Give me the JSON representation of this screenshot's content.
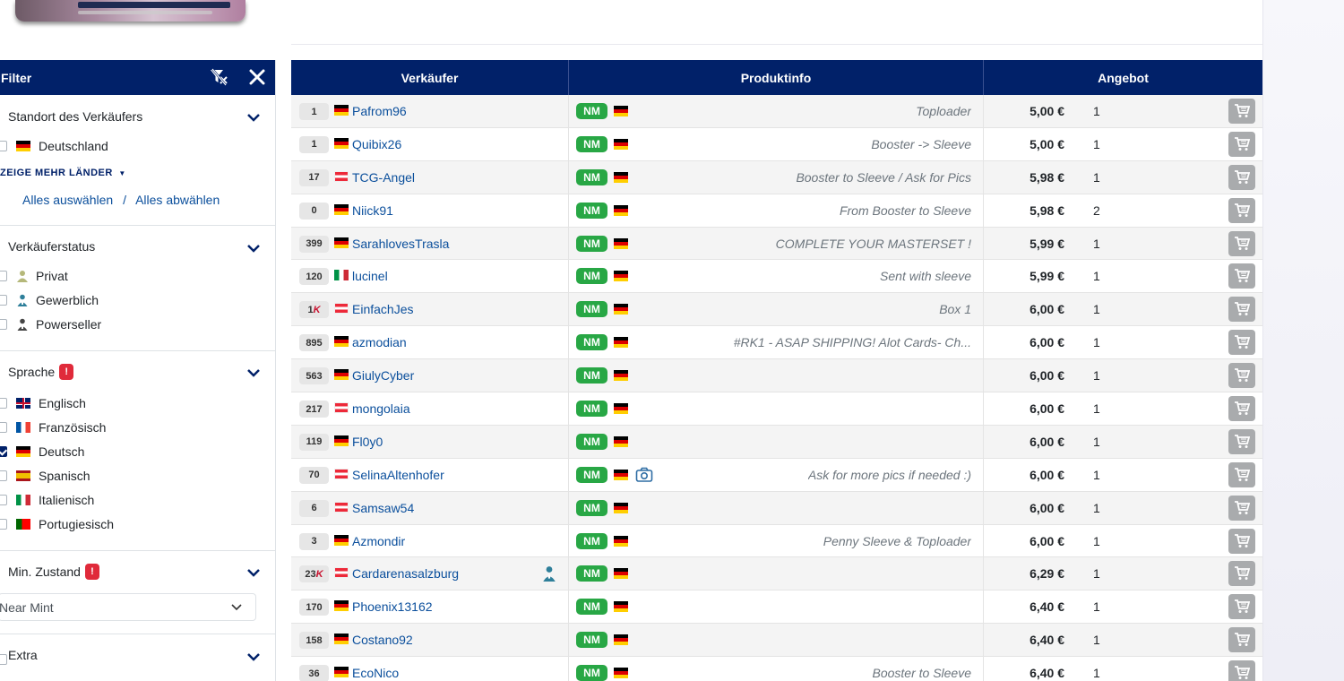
{
  "colors": {
    "navy": "#012169",
    "nm_green": "#28a745",
    "link": "#0b4f9c",
    "badge_red": "#e02a3a"
  },
  "filter": {
    "title": "Filter",
    "location": {
      "title": "Standort des Verkäufers",
      "country": "Deutschland",
      "more": "ZEIGE MEHR LÄNDER",
      "select_all": "Alles auswählen",
      "separator": "/",
      "deselect_all": "Alles abwählen"
    },
    "seller_status": {
      "title": "Verkäuferstatus",
      "options": [
        "Privat",
        "Gewerblich",
        "Powerseller"
      ]
    },
    "language": {
      "title": "Sprache",
      "badge": "!",
      "options": [
        "Englisch",
        "Französisch",
        "Deutsch",
        "Spanisch",
        "Italienisch",
        "Portugiesisch"
      ]
    },
    "min_condition": {
      "title": "Min. Zustand",
      "badge": "!",
      "value": "Near Mint"
    },
    "extra": {
      "title": "Extra"
    }
  },
  "table": {
    "headers": [
      "Verkäufer",
      "Produktinfo",
      "Angebot"
    ],
    "rows": [
      {
        "sales": "1",
        "flag": "de",
        "seller": "Pafrom96",
        "condition": "NM",
        "comment": "Toploader",
        "price": "5,00 €",
        "qty": "1"
      },
      {
        "sales": "1",
        "flag": "de",
        "seller": "Quibix26",
        "condition": "NM",
        "comment": "Booster -> Sleeve",
        "price": "5,00 €",
        "qty": "1"
      },
      {
        "sales": "17",
        "flag": "at",
        "seller": "TCG-Angel",
        "condition": "NM",
        "comment": "Booster to Sleeve / Ask for Pics",
        "price": "5,98 €",
        "qty": "1"
      },
      {
        "sales": "0",
        "flag": "de",
        "seller": "Niick91",
        "condition": "NM",
        "comment": "From Booster to Sleeve",
        "price": "5,98 €",
        "qty": "2"
      },
      {
        "sales": "399",
        "flag": "de",
        "seller": "SarahlovesTrasla",
        "condition": "NM",
        "comment": "COMPLETE YOUR MASTERSET !",
        "price": "5,99 €",
        "qty": "1"
      },
      {
        "sales": "120",
        "flag": "it",
        "seller": "lucinel",
        "condition": "NM",
        "comment": "Sent with sleeve",
        "price": "5,99 €",
        "qty": "1"
      },
      {
        "sales": "1",
        "sales_k": "K",
        "flag": "at",
        "seller": "EinfachJes",
        "condition": "NM",
        "comment": "Box 1",
        "price": "6,00 €",
        "qty": "1"
      },
      {
        "sales": "895",
        "flag": "de",
        "seller": "azmodian",
        "condition": "NM",
        "comment": "#RK1 - ASAP SHIPPING! Alot Cards- Ch...",
        "price": "6,00 €",
        "qty": "1"
      },
      {
        "sales": "563",
        "flag": "de",
        "seller": "GiulyCyber",
        "condition": "NM",
        "comment": "",
        "price": "6,00 €",
        "qty": "1"
      },
      {
        "sales": "217",
        "flag": "at",
        "seller": "mongolaia",
        "condition": "NM",
        "comment": "",
        "price": "6,00 €",
        "qty": "1"
      },
      {
        "sales": "119",
        "flag": "de",
        "seller": "Fl0y0",
        "condition": "NM",
        "comment": "",
        "price": "6,00 €",
        "qty": "1"
      },
      {
        "sales": "70",
        "flag": "at",
        "seller": "SelinaAltenhofer",
        "condition": "NM",
        "camera": true,
        "comment": "Ask for more pics if needed :)",
        "price": "6,00 €",
        "qty": "1"
      },
      {
        "sales": "6",
        "flag": "at",
        "seller": "Samsaw54",
        "condition": "NM",
        "comment": "",
        "price": "6,00 €",
        "qty": "1"
      },
      {
        "sales": "3",
        "flag": "de",
        "seller": "Azmondir",
        "condition": "NM",
        "comment": "Penny Sleeve & Toploader",
        "price": "6,00 €",
        "qty": "1"
      },
      {
        "sales": "23",
        "sales_k": "K",
        "flag": "at",
        "seller": "Cardarenasalzburg",
        "professional": true,
        "condition": "NM",
        "comment": "",
        "price": "6,29 €",
        "qty": "1"
      },
      {
        "sales": "170",
        "flag": "de",
        "seller": "Phoenix13162",
        "condition": "NM",
        "comment": "",
        "price": "6,40 €",
        "qty": "1"
      },
      {
        "sales": "158",
        "flag": "de",
        "seller": "Costano92",
        "condition": "NM",
        "comment": "",
        "price": "6,40 €",
        "qty": "1"
      },
      {
        "sales": "36",
        "flag": "de",
        "seller": "EcoNico",
        "condition": "NM",
        "comment": "Booster to Sleeve",
        "price": "6,40 €",
        "qty": "1"
      }
    ]
  }
}
